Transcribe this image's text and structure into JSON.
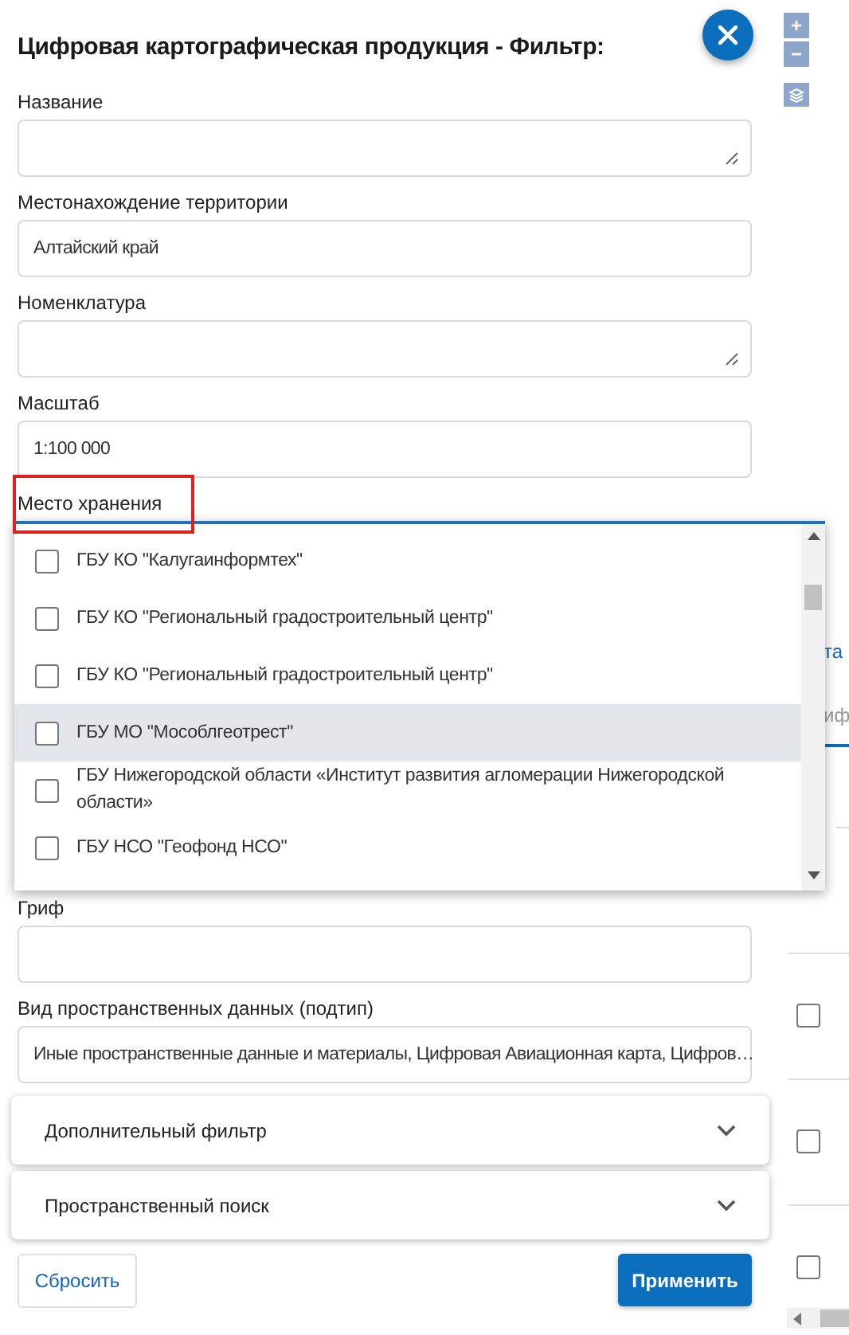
{
  "title": "Цифровая картографическая продукция - Фильтр:",
  "fields_top": [
    {
      "label": "Название",
      "kind": "textarea"
    },
    {
      "label": "Местонахождение территории",
      "kind": "input",
      "value": "Алтайский край"
    },
    {
      "label": "Номенклатура",
      "kind": "textarea"
    },
    {
      "label": "Масштаб",
      "kind": "input",
      "value": "1:100 000"
    }
  ],
  "storage": {
    "label": "Место хранения",
    "marked": true,
    "open": true,
    "options": [
      {
        "label": "ГБУ КО \"Калугаинформтех\"",
        "checked": false,
        "highlighted": false
      },
      {
        "label": "ГБУ КО \"Региональный градостроительный центр\"",
        "checked": false,
        "highlighted": false
      },
      {
        "label": "ГБУ КО \"Региональный градостроительный центр\"",
        "checked": false,
        "highlighted": false
      },
      {
        "label": "ГБУ МО \"Мособлгеотрест\"",
        "checked": false,
        "highlighted": true
      },
      {
        "label": "ГБУ Нижегородской области «Институт развития агломерации Нижегородской области»",
        "checked": false,
        "highlighted": false
      },
      {
        "label": "ГБУ НСО \"Геофонд НСО\"",
        "checked": false,
        "highlighted": false
      }
    ]
  },
  "fields_bottom": [
    {
      "label": "Гриф"
    },
    {
      "label": "Вид пространственных данных (подтип)",
      "value": "Иные пространственные данные и материалы, Цифровая Авиационная карта, Цифров…"
    }
  ],
  "accordions": [
    {
      "label": "Дополнительный фильтр",
      "expanded": false
    },
    {
      "label": "Пространственный поиск",
      "expanded": false
    }
  ],
  "buttons": {
    "reset": "Сбросить",
    "apply": "Применить"
  },
  "map_controls": {
    "zoom_in": "+",
    "zoom_out": "−"
  },
  "background_table": {
    "texts": [
      "та",
      "иф"
    ],
    "checkboxes": [
      {
        "checked": false
      },
      {
        "checked": false
      },
      {
        "checked": false
      }
    ]
  }
}
